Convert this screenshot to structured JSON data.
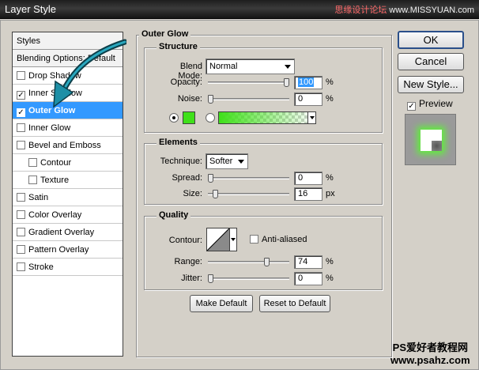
{
  "window": {
    "title": "Layer Style"
  },
  "watermark": {
    "top_cn": "思缘设计论坛",
    "top_url": "www.MISSYUAN.com",
    "bottom_line1": "PS爱好者教程网",
    "bottom_line2": "www.psahz.com"
  },
  "styles_list": {
    "header": "Styles",
    "blending": "Blending Options: Default",
    "items": [
      {
        "label": "Drop Shadow",
        "checked": false
      },
      {
        "label": "Inner Shadow",
        "checked": true
      },
      {
        "label": "Outer Glow",
        "checked": true,
        "selected": true
      },
      {
        "label": "Inner Glow",
        "checked": false
      },
      {
        "label": "Bevel and Emboss",
        "checked": false
      },
      {
        "label": "Contour",
        "checked": false,
        "sub": true
      },
      {
        "label": "Texture",
        "checked": false,
        "sub": true
      },
      {
        "label": "Satin",
        "checked": false
      },
      {
        "label": "Color Overlay",
        "checked": false
      },
      {
        "label": "Gradient Overlay",
        "checked": false
      },
      {
        "label": "Pattern Overlay",
        "checked": false
      },
      {
        "label": "Stroke",
        "checked": false
      }
    ]
  },
  "panel": {
    "title": "Outer Glow",
    "structure": {
      "title": "Structure",
      "blend_mode_label": "Blend Mode:",
      "blend_mode": "Normal",
      "opacity_label": "Opacity:",
      "opacity": "100",
      "opacity_unit": "%",
      "opacity_level": 1.0,
      "noise_label": "Noise:",
      "noise": "0",
      "noise_unit": "%",
      "noise_level": 0,
      "glow_color": "#3fe01a"
    },
    "elements": {
      "title": "Elements",
      "technique_label": "Technique:",
      "technique": "Softer",
      "spread_label": "Spread:",
      "spread": "0",
      "spread_unit": "%",
      "spread_level": 0,
      "size_label": "Size:",
      "size": "16",
      "size_unit": "px",
      "size_level": 0.064
    },
    "quality": {
      "title": "Quality",
      "contour_label": "Contour:",
      "antialiased_label": "Anti-aliased",
      "antialiased": false,
      "range_label": "Range:",
      "range": "74",
      "range_unit": "%",
      "range_level": 0.74,
      "jitter_label": "Jitter:",
      "jitter": "0",
      "jitter_unit": "%",
      "jitter_level": 0
    },
    "make_default": "Make Default",
    "reset_default": "Reset to Default"
  },
  "buttons": {
    "ok": "OK",
    "cancel": "Cancel",
    "new_style": "New Style...",
    "preview_label": "Preview",
    "preview_checked": true
  }
}
